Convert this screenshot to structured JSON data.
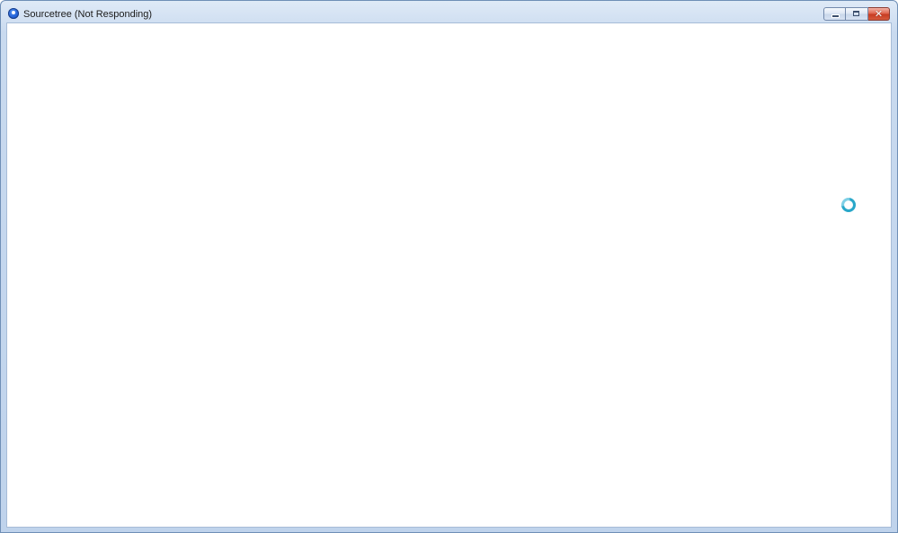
{
  "window": {
    "title": "Sourcetree (Not Responding)",
    "app_icon": "sourcetree-icon",
    "caption_buttons": {
      "minimize_icon": "minimize-icon",
      "maximize_icon": "maximize-icon",
      "close_icon": "close-icon",
      "close_glyph": "✕"
    }
  },
  "client_area": {
    "state": "not-responding",
    "cursor_icon": "busy-spinner-icon"
  },
  "colors": {
    "titlebar": "#c9daef",
    "client_background": "#ffffff",
    "close_button": "#d0472b",
    "spinner": "#29a7c9"
  }
}
